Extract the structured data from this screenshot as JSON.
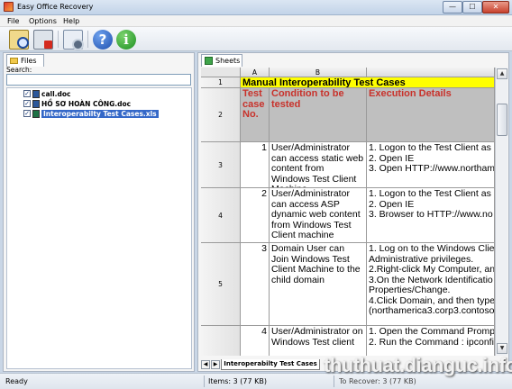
{
  "window": {
    "title": "Easy Office Recovery",
    "min": "—",
    "max": "☐",
    "close": "✕"
  },
  "menu": [
    "File",
    "Options",
    "Help"
  ],
  "toolbar": {
    "help_glyph": "?",
    "info_glyph": "i"
  },
  "left": {
    "tab_label": "Files",
    "search_label": "Search:",
    "search_value": "",
    "files": [
      {
        "name": "call.doc",
        "checked": true,
        "icon": "word-icon"
      },
      {
        "name": "HỒ SƠ HOÀN CÔNG.doc",
        "checked": true,
        "icon": "word-icon"
      },
      {
        "name": "Interoperabilty Test Cases.xls",
        "checked": true,
        "icon": "excel-icon",
        "selected": true
      }
    ]
  },
  "right": {
    "tab_label": "Sheets",
    "columns": [
      "A",
      "B"
    ],
    "rows": [
      "1",
      "2",
      "3",
      "4",
      "5"
    ],
    "title_cell": "Manual Interoperability Test Cases",
    "headers": {
      "a": "Test case No.",
      "b": "Condition to be tested",
      "c": "Execution Details"
    },
    "data": [
      {
        "a": "1",
        "b": "User/Administrator can access static web content from Windows Test Client Machine",
        "c": "1. Logon to the Test Client as\n2. Open IE\n3. Open HTTP://www.northam"
      },
      {
        "a": "2",
        "b": "User/Administrator can access ASP dynamic web content from Windows Test Client machine",
        "c": "1. Logon to the Test Client as\n2. Open IE\n3. Browser to HTTP://www.no"
      },
      {
        "a": "3",
        "b": "Domain User can Join Windows Test Client  Machine to the child domain",
        "c": "1. Log on to the Windows Clie\nAdministrative privileges.\n2.Right-click My Computer, an\n3.On the Network Identificatio\nProperties/Change.\n4.Click Domain, and then type\n(northamerica3.corp3.contoso"
      },
      {
        "a": "4",
        "b": "User/Administrator on Windows Test client",
        "c": "1. Open the Command Promp\n2. Run the Command : ipconfi"
      }
    ],
    "sheet_tab": "Interoperabilty Test Cases",
    "nav_first": "◀",
    "nav_next": "▶"
  },
  "status": {
    "ready": "Ready",
    "items": "Items: 3 (77 KB)",
    "to_recover": "To Recover: 3 (77 KB)"
  },
  "watermark": "thuthuat.dianguc.info"
}
